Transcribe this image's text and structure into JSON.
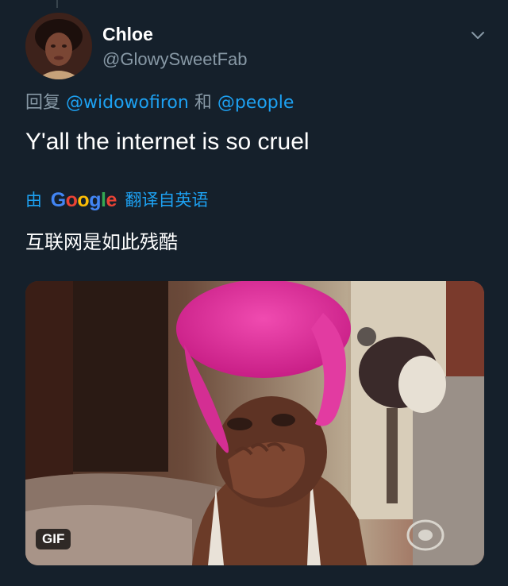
{
  "author": {
    "display_name": "Chloe",
    "handle": "@GlowySweetFab"
  },
  "icons": {
    "caret": "chevron-down-icon",
    "avatar": "profile-photo"
  },
  "reply": {
    "prefix": "回复",
    "mention_1": "@widowofiron",
    "conjunction": "和",
    "mention_2": "@people"
  },
  "tweet": {
    "text": "Y'all the internet is so cruel"
  },
  "translation": {
    "by_label": "由",
    "provider_letters": [
      "G",
      "o",
      "o",
      "g",
      "l",
      "e"
    ],
    "from_label": "翻译自英语",
    "translated_text": "互联网是如此残酷"
  },
  "media": {
    "badge": "GIF"
  },
  "colors": {
    "background": "#15202b",
    "secondary_text": "#8899a6",
    "link": "#1da1f2",
    "primary_text": "#ffffff"
  }
}
